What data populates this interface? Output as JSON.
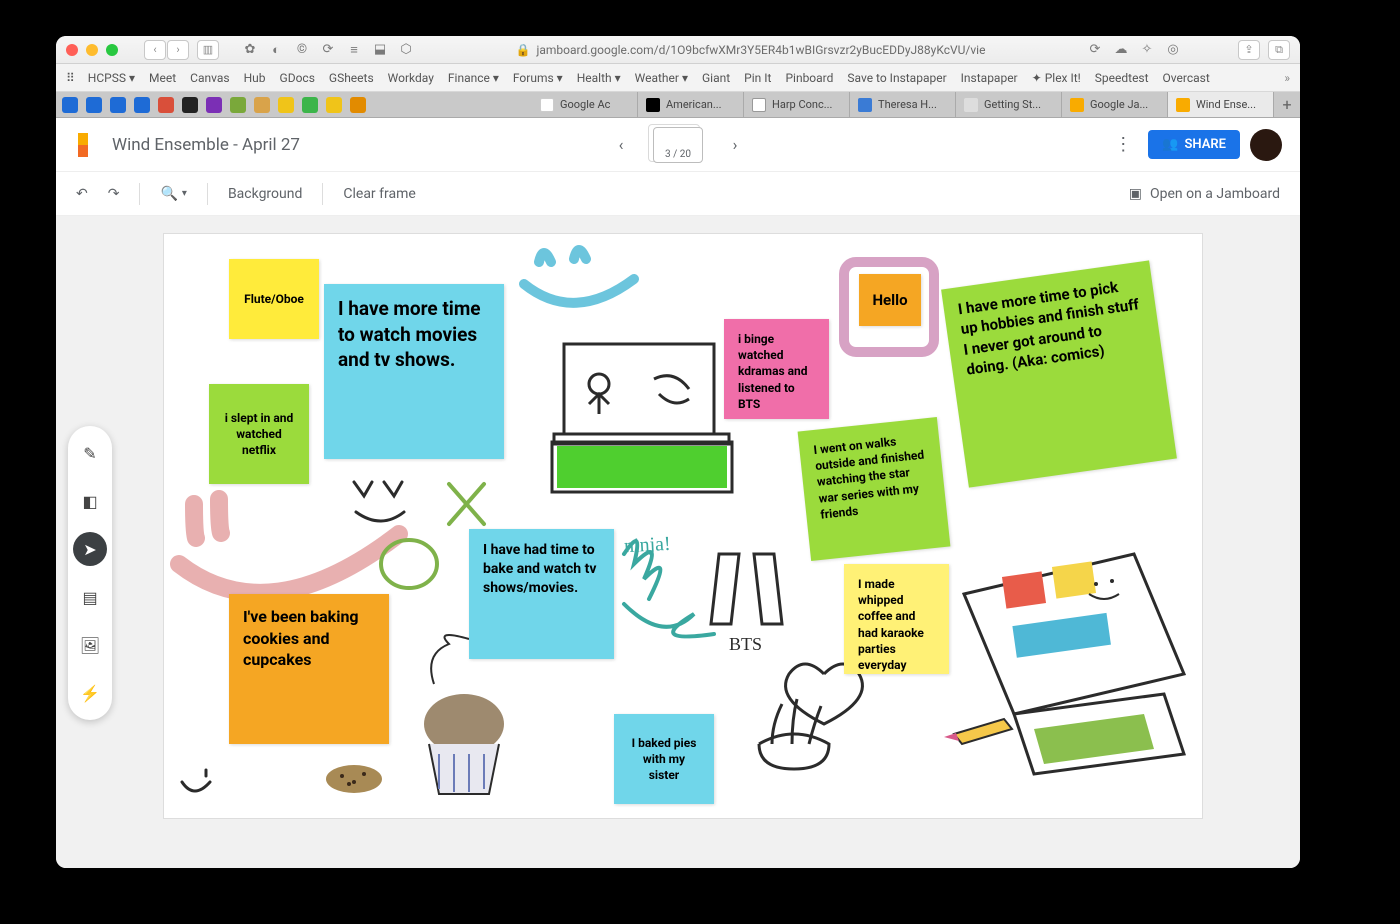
{
  "browser": {
    "address": "jamboard.google.com/d/1O9bcfwXMr3Y5ER4b1wBIGrsvzr2yBucEDDyJ88yKcVU/vie",
    "bookmarks": [
      "HCPSS",
      "Meet",
      "Canvas",
      "Hub",
      "GDocs",
      "GSheets",
      "Workday",
      "Finance",
      "Forums",
      "Health",
      "Weather",
      "Giant",
      "Pin It",
      "Pinboard",
      "Save to Instapaper",
      "Instapaper",
      "Plex It!",
      "Speedtest",
      "Overcast"
    ],
    "bookmark_dropdowns": [
      true,
      false,
      false,
      false,
      false,
      false,
      false,
      true,
      true,
      true,
      true,
      false,
      false,
      false,
      false,
      false,
      false,
      false,
      false
    ],
    "tabs": [
      {
        "label": "Google Ac",
        "icon": "#fff"
      },
      {
        "label": "American...",
        "icon": "#000"
      },
      {
        "label": "Harp Conc...",
        "icon": "#fff"
      },
      {
        "label": "Theresa H...",
        "icon": "#3a7bd5"
      },
      {
        "label": "Getting St...",
        "icon": "#ddd"
      },
      {
        "label": "Google Ja...",
        "icon": "#f9ab00"
      },
      {
        "label": "Wind Ense...",
        "icon": "#f9ab00",
        "active": true
      }
    ]
  },
  "app": {
    "title": "Wind Ensemble - April 27",
    "frame": "3 / 20",
    "share": "SHARE",
    "background": "Background",
    "clear": "Clear frame",
    "open": "Open on a Jamboard"
  },
  "notes": {
    "n1": "Flute/Oboe",
    "n2": "I have more time to watch movies and tv shows.",
    "n3": "i slept in and watched netflix",
    "n4": "i binge watched kdramas and listened to BTS",
    "n5": "Hello",
    "n6": "I have more time to pick up hobbies and finish stuff I never got around to doing. (Aka: comics)",
    "n7": "I went on walks outside and finished watching the star war series with my friends",
    "n8": "I have had time to bake and watch tv shows/movies.",
    "n9": "I made whipped coffee and had karaoke parties everyday",
    "n10": "I've been baking cookies and cupcakes",
    "n11": "I baked pies with my sister",
    "bts": "BTS",
    "ninja": "ninja!"
  }
}
